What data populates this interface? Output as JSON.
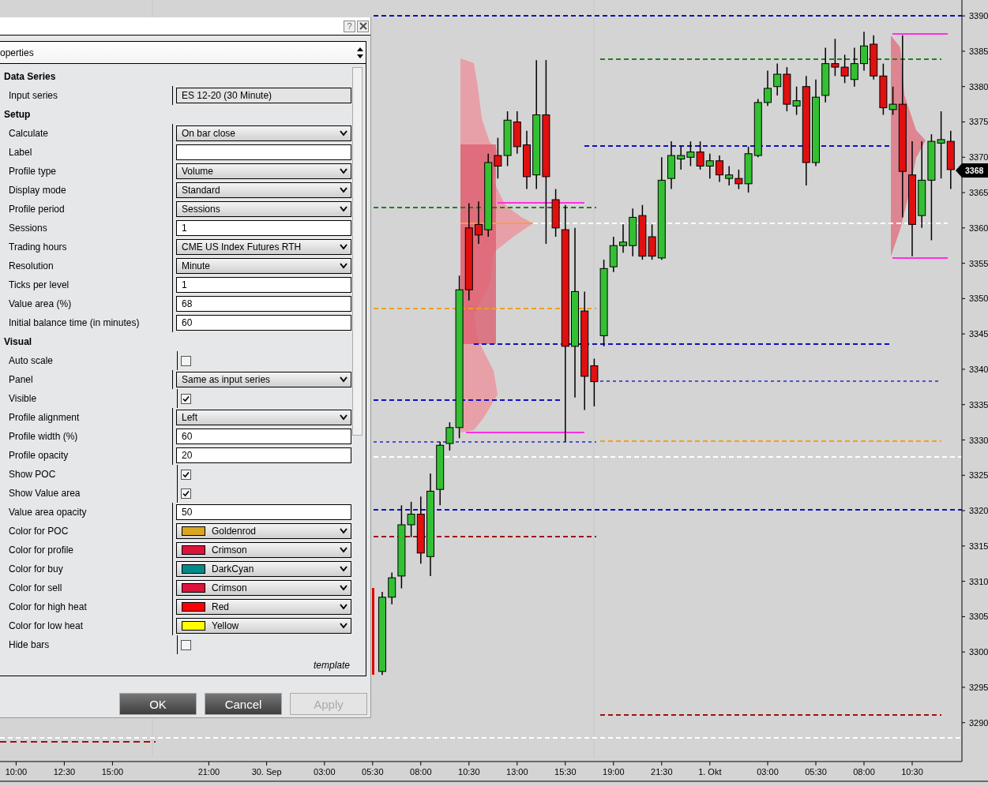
{
  "dialog": {
    "help_button": "?",
    "tab": {
      "label": "operties"
    },
    "sections": [
      {
        "title": "Data Series",
        "rows": [
          {
            "label": "Input series",
            "kind": "readonly",
            "value": "ES 12-20 (30 Minute)"
          }
        ]
      },
      {
        "title": "Setup",
        "rows": [
          {
            "label": "Calculate",
            "kind": "dropdown",
            "value": "On bar close"
          },
          {
            "label": "Label",
            "kind": "input",
            "value": ""
          },
          {
            "label": "Profile type",
            "kind": "dropdown",
            "value": "Volume"
          },
          {
            "label": "Display mode",
            "kind": "dropdown",
            "value": "Standard"
          },
          {
            "label": "Profile period",
            "kind": "dropdown",
            "value": "Sessions"
          },
          {
            "label": "Sessions",
            "kind": "input",
            "value": "1"
          },
          {
            "label": "Trading hours",
            "kind": "dropdown",
            "value": "CME US Index Futures RTH"
          },
          {
            "label": "Resolution",
            "kind": "dropdown",
            "value": "Minute"
          },
          {
            "label": "Ticks per level",
            "kind": "input",
            "value": "1"
          },
          {
            "label": "Value area (%)",
            "kind": "input",
            "value": "68"
          },
          {
            "label": "Initial balance time (in minutes)",
            "kind": "input",
            "value": "60"
          }
        ]
      },
      {
        "title": "Visual",
        "rows": [
          {
            "label": "Auto scale",
            "kind": "checkbox",
            "checked": false
          },
          {
            "label": "Panel",
            "kind": "dropdown",
            "value": "Same as input series"
          },
          {
            "label": "Visible",
            "kind": "checkbox",
            "checked": true
          },
          {
            "label": "Profile alignment",
            "kind": "dropdown",
            "value": "Left"
          },
          {
            "label": "Profile width (%)",
            "kind": "input",
            "value": "60"
          },
          {
            "label": "Profile opacity",
            "kind": "input",
            "value": "20"
          },
          {
            "label": "Show POC",
            "kind": "checkbox",
            "checked": true
          },
          {
            "label": "Show Value area",
            "kind": "checkbox",
            "checked": true
          },
          {
            "label": "Value area opacity",
            "kind": "input",
            "value": "50"
          },
          {
            "label": "Color for POC",
            "kind": "color",
            "value": "Goldenrod",
            "color": "#daa520"
          },
          {
            "label": "Color for profile",
            "kind": "color",
            "value": "Crimson",
            "color": "#dc143c"
          },
          {
            "label": "Color for buy",
            "kind": "color",
            "value": "DarkCyan",
            "color": "#008b8b"
          },
          {
            "label": "Color for sell",
            "kind": "color",
            "value": "Crimson",
            "color": "#dc143c"
          },
          {
            "label": "Color for high heat",
            "kind": "color",
            "value": "Red",
            "color": "#ff0000"
          },
          {
            "label": "Color for low heat",
            "kind": "color",
            "value": "Yellow",
            "color": "#ffff00"
          },
          {
            "label": "Hide bars",
            "kind": "checkbox",
            "checked": false
          }
        ]
      }
    ],
    "template_link": "template",
    "buttons": [
      {
        "label": "OK",
        "disabled": false
      },
      {
        "label": "Cancel",
        "disabled": false
      },
      {
        "label": "Apply",
        "disabled": true
      }
    ]
  },
  "chart": {
    "chart_data": {
      "type": "candlestick",
      "categories": [
        "10:00",
        null,
        null,
        null,
        null,
        "12:30",
        null,
        null,
        null,
        null,
        "15:00",
        null,
        null,
        null,
        null,
        null,
        null,
        null,
        null,
        null,
        "21:00",
        null,
        null,
        null,
        null,
        null,
        "30. Sep",
        null,
        null,
        null,
        null,
        null,
        "03:00",
        null,
        null,
        null,
        null,
        "05:30",
        null,
        null,
        null,
        null,
        "08:00",
        null,
        null,
        null,
        null,
        "10:30",
        null,
        null,
        null,
        null,
        "13:00",
        null,
        null,
        null,
        null,
        "15:30",
        null,
        null,
        null,
        null,
        "19:00",
        null,
        null,
        null,
        null,
        "21:30",
        null,
        null,
        null,
        null,
        "1. Okt",
        null,
        null,
        null,
        null,
        null,
        "03:00",
        null,
        null,
        null,
        null,
        "05:30",
        null,
        null,
        null,
        null,
        "08:00",
        null,
        null,
        null,
        null,
        "10:30",
        null,
        null,
        null,
        null
      ],
      "ylim": [
        3284.5,
        3392.25
      ],
      "yticks": [
        3390,
        3385,
        3380,
        3375,
        3370,
        3365,
        3360,
        3355,
        3350,
        3345,
        3340,
        3335,
        3330,
        3325,
        3320,
        3315,
        3310,
        3305,
        3300,
        3295,
        3290
      ],
      "ohlc": [
        null,
        null,
        null,
        null,
        null,
        null,
        null,
        null,
        null,
        null,
        null,
        null,
        null,
        null,
        null,
        null,
        null,
        null,
        null,
        null,
        null,
        null,
        null,
        null,
        null,
        null,
        null,
        null,
        null,
        null,
        null,
        null,
        null,
        null,
        null,
        null,
        null,
        null,
        [
          3297.25,
          3308.5,
          3296.75,
          3307.75
        ],
        [
          3307.75,
          3311.25,
          3306.75,
          3310.5
        ],
        [
          3310.75,
          3320.75,
          3309,
          3318
        ],
        [
          3318,
          3321.25,
          3316.25,
          3319.5
        ],
        [
          3319.5,
          3322,
          3312.5,
          3314
        ],
        [
          3313.5,
          3325.25,
          3310.75,
          3322.75
        ],
        [
          3323,
          3329.75,
          3320.75,
          3329.25
        ],
        [
          3329.5,
          3332.5,
          3328.5,
          3331.75
        ],
        [
          3331.75,
          3353.25,
          3330.25,
          3351.25
        ],
        [
          3360,
          3363.5,
          3349.75,
          3351.25
        ],
        [
          3360.5,
          3363.75,
          3357.75,
          3359
        ],
        [
          3359.75,
          3370.5,
          3358.75,
          3369.25
        ],
        [
          3370.25,
          3372.75,
          3367,
          3368.75
        ],
        [
          3370.25,
          3376.5,
          3368.75,
          3375.25
        ],
        [
          3375,
          3376.5,
          3370.5,
          3371.5
        ],
        [
          3371.75,
          3373.75,
          3365.5,
          3367.25
        ],
        [
          3367.5,
          3383.75,
          3365.5,
          3376
        ],
        [
          3376,
          3383.75,
          3357.75,
          3367.25
        ],
        [
          3364,
          3365.5,
          3358.75,
          3360
        ],
        [
          3359.75,
          3363.25,
          3329.75,
          3343.25
        ],
        [
          3343.25,
          3360,
          3336,
          3351
        ],
        [
          3348.25,
          3351,
          3334.25,
          3339
        ],
        [
          3340.5,
          3341.5,
          3334.75,
          3338.25
        ],
        [
          3344.75,
          3355.5,
          3343.25,
          3354.25
        ],
        [
          3354.5,
          3358.75,
          3353.75,
          3357.5
        ],
        [
          3357.5,
          3360.5,
          3356.5,
          3358
        ],
        [
          3357.5,
          3362.75,
          3356,
          3361.5
        ],
        [
          3361.75,
          3363.25,
          3355.5,
          3356
        ],
        [
          3358.75,
          3360.5,
          3355.5,
          3356
        ],
        [
          3355.75,
          3370,
          3355.5,
          3366.75
        ],
        [
          3367,
          3372.25,
          3365.5,
          3370.25
        ],
        [
          3369.75,
          3371.5,
          3368.25,
          3370.25
        ],
        [
          3370,
          3372.25,
          3368.75,
          3370.75
        ],
        [
          3370.75,
          3372.25,
          3368.25,
          3368.75
        ],
        [
          3368.75,
          3370.5,
          3367,
          3369.5
        ],
        [
          3369.5,
          3370.25,
          3366.5,
          3367.5
        ],
        [
          3367,
          3368.75,
          3366,
          3367.5
        ],
        [
          3367,
          3368.25,
          3365.5,
          3366.25
        ],
        [
          3366.25,
          3371.5,
          3365,
          3370.5
        ],
        [
          3370.25,
          3378.25,
          3370,
          3377.75
        ],
        [
          3377.75,
          3382.25,
          3377.25,
          3379.75
        ],
        [
          3380,
          3383.25,
          3378.75,
          3381.75
        ],
        [
          3381.75,
          3382.75,
          3376.5,
          3377.5
        ],
        [
          3377.25,
          3380,
          3376,
          3378
        ],
        [
          3380,
          3381.5,
          3366,
          3369.25
        ],
        [
          3369.25,
          3381,
          3368.75,
          3378.5
        ],
        [
          3378.75,
          3385.5,
          3377.75,
          3383.25
        ],
        [
          3383.25,
          3386.75,
          3381.5,
          3382.75
        ],
        [
          3382.75,
          3384.5,
          3380.5,
          3381.5
        ],
        [
          3381,
          3385.5,
          3380,
          3383.25
        ],
        [
          3383.25,
          3387.75,
          3382.25,
          3385.75
        ],
        [
          3386,
          3387.25,
          3381,
          3381.5
        ],
        [
          3381.5,
          3383.25,
          3376,
          3377
        ],
        [
          3376.75,
          3380,
          3376,
          3377.5
        ],
        [
          3377.5,
          3387.25,
          3361.5,
          3368
        ],
        [
          3367.5,
          3372.25,
          3356,
          3360.5
        ],
        [
          3361.75,
          3372.25,
          3360,
          3366.75
        ],
        [
          3366.75,
          3373.25,
          3358.25,
          3372.25
        ],
        [
          3372,
          3376.5,
          3367,
          3372.5
        ],
        [
          3372.25,
          3373.75,
          3365.5,
          3368.25
        ]
      ]
    },
    "price_marker": "3368"
  }
}
